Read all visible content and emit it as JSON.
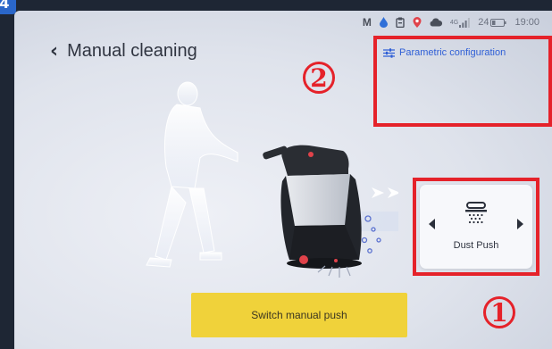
{
  "status_bar": {
    "m_label": "M",
    "signal_label": "4G",
    "battery_text": "24",
    "time": "19:00",
    "icons": [
      "drop-icon",
      "clipboard-icon",
      "location-pin-icon",
      "cloud-icon",
      "signal-icon",
      "battery-icon"
    ]
  },
  "header": {
    "title": "Manual cleaning",
    "param_config_label": "Parametric configuration"
  },
  "mode_selector": {
    "current_mode": "Dust Push"
  },
  "actions": {
    "switch_label": "Switch manual push"
  },
  "annotations": {
    "box_param_number": "2",
    "box_mode_number": "1",
    "corner_badge": "4"
  },
  "colors": {
    "accent_blue": "#2f5fd6",
    "button_yellow": "#f0d23a",
    "annotation_red": "#e5222a"
  }
}
